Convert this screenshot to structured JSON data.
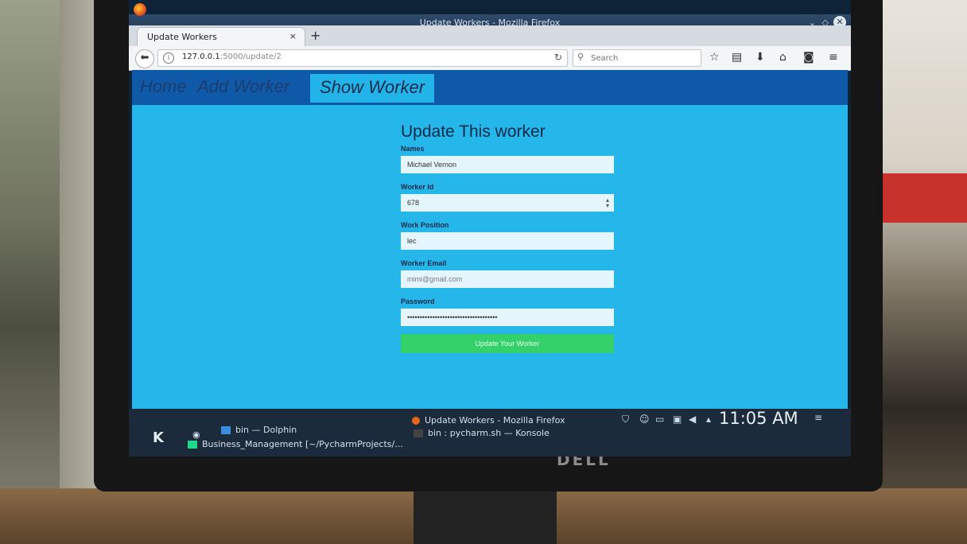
{
  "titlebar": {
    "title": "Update Workers - Mozilla Firefox"
  },
  "browser": {
    "tab_title": "Update Workers",
    "tab_close": "×",
    "new_tab": "+",
    "url_host": "127.0.0.1",
    "url_path": ":5000/update/2",
    "search_placeholder": "Search"
  },
  "nav": {
    "home": "Home",
    "add_worker": "Add Worker",
    "show_worker": "Show Worker"
  },
  "form": {
    "heading": "Update This worker",
    "name_label": "Names",
    "name_value": "Michael Vernon",
    "id_label": "Worker Id",
    "id_value": "678",
    "position_label": "Work Position",
    "position_value": "lec",
    "email_label": "Worker Email",
    "email_placeholder": "mimi@gmail.com",
    "password_label": "Password",
    "password_value": "••••••••••••••••••••••••••••••••••••",
    "submit_label": "Update Your Worker"
  },
  "taskbar": {
    "dolphin": "bin — Dolphin",
    "firefox": "Update Workers - Mozilla Firefox",
    "pycharm": "Business_Management [~/PycharmProjects/...",
    "konsole": "bin : pycharm.sh — Konsole",
    "clock": "11:05 AM"
  },
  "monitor": {
    "brand": "DELL"
  },
  "colors": {
    "page_bg": "#25b6ea",
    "nav_bg": "#0f5aa8",
    "submit_bg": "#34d06a"
  }
}
